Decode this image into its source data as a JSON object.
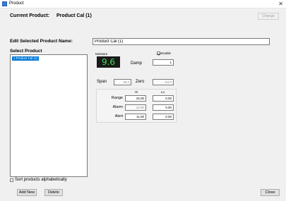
{
  "window": {
    "title": "Product",
    "close_glyph": "✕"
  },
  "current_product": {
    "label": "Current Product:",
    "value": "Product Cal (1)",
    "change_button": "Change"
  },
  "edit": {
    "label": "Edit Selected Product Name:",
    "value": "Product Cal (1)"
  },
  "select": {
    "label": "Select Product",
    "items": [
      {
        "label": "1 Product Cal (1)",
        "selected": true
      }
    ]
  },
  "panel": {
    "moisture_label": "Moisture",
    "enable_label": "Enable",
    "enable_checked": true,
    "display_value": "9.6",
    "damp_label": "Damp",
    "damp_value": "1",
    "span_label": "Span",
    "span_value": "29.0",
    "zero_label": "Zero",
    "zero_value": "-64.0",
    "hi_header": "Hi",
    "lo_header": "Lo",
    "rows": [
      {
        "label": "Range",
        "hi": "15.00",
        "lo": "0.00",
        "hi_disabled": false
      },
      {
        "label": "Alarm",
        "hi": "12.00",
        "lo": "0.00",
        "hi_disabled": true
      },
      {
        "label": "Alert",
        "hi": "11.00",
        "lo": "0.00",
        "hi_disabled": false
      }
    ]
  },
  "sort": {
    "label": "Sort products alphabetically",
    "checked": false
  },
  "buttons": {
    "add_new": "Add New",
    "delete": "Delete",
    "close": "Close"
  }
}
